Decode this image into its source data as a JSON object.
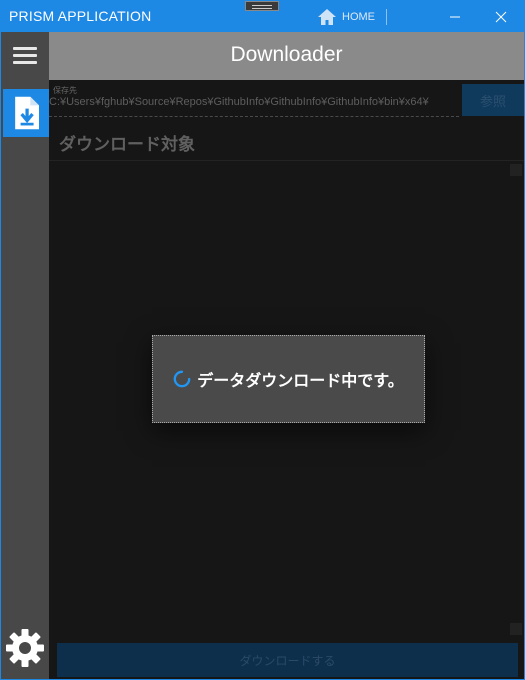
{
  "titlebar": {
    "app_title": "PRISM APPLICATION",
    "home_label": "HOME",
    "accent_color": "#1e88e5",
    "icons": [
      "home-icon",
      "minimize-icon",
      "maximize-icon",
      "close-icon"
    ]
  },
  "header": {
    "title": "Downloader"
  },
  "sidebar": {
    "items": [
      {
        "icon": "hamburger-menu-icon"
      },
      {
        "icon": "download-file-icon",
        "active": true
      },
      {
        "icon": "gear-icon"
      }
    ]
  },
  "main": {
    "save_location_label": "保存先",
    "save_path": "C:¥Users¥fghub¥Source¥Repos¥GithubInfo¥GithubInfo¥GithubInfo¥bin¥x64¥",
    "browse_label": "参照",
    "section_title": "ダウンロード対象",
    "download_button_label": "ダウンロードする"
  },
  "dialog": {
    "message": "データダウンロード中です。",
    "icon": "loading-spinner-icon"
  }
}
